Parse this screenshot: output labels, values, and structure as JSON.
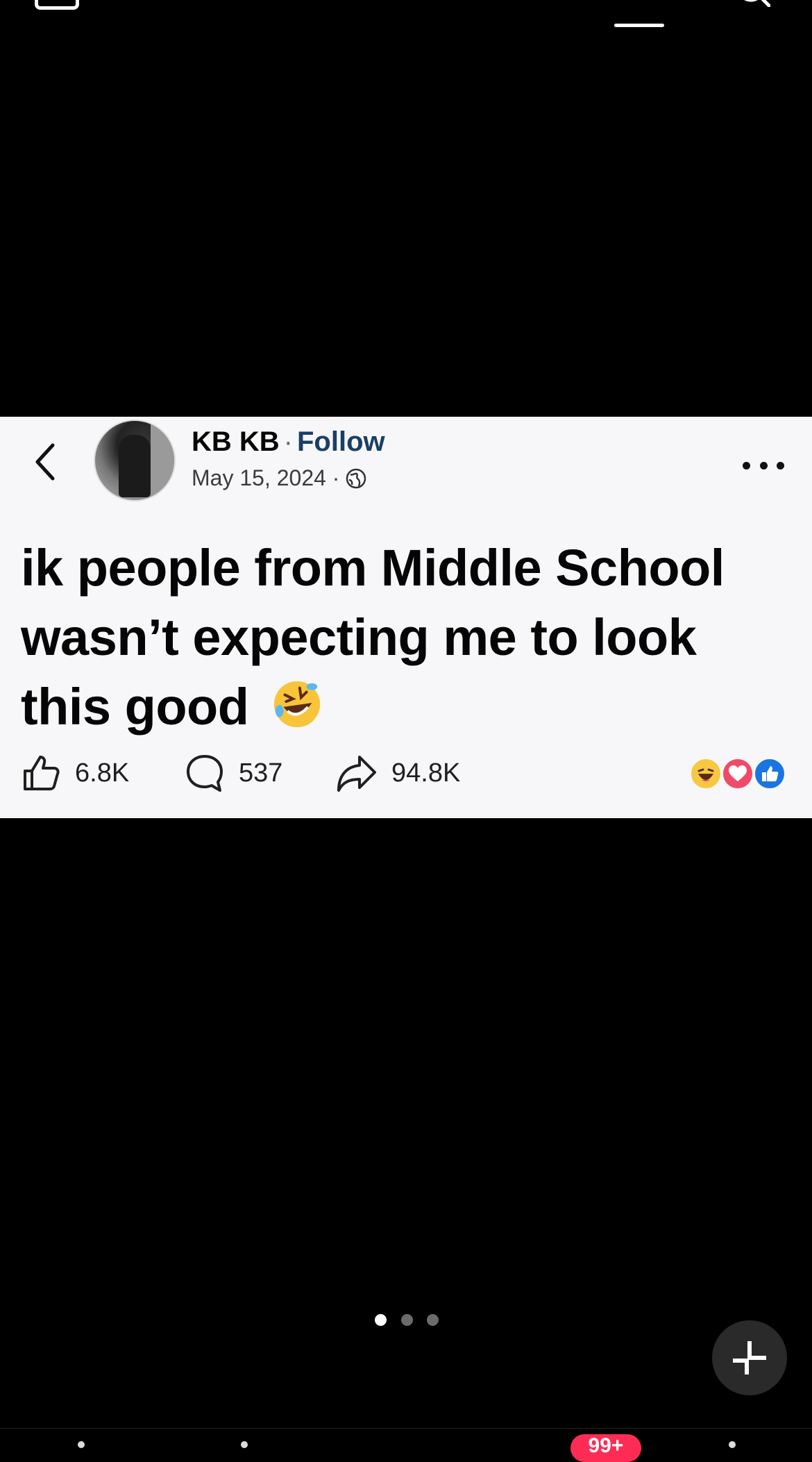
{
  "post": {
    "author": "KB KB",
    "separator": "·",
    "follow_label": "Follow",
    "date": "May 15, 2024 ·",
    "text": "ik people from Middle School wasn’t expecting me to look this good",
    "emoji": "rolling-on-floor-laughing-emoji",
    "stats": {
      "likes": "6.8K",
      "comments": "537",
      "shares": "94.8K"
    },
    "reactions": [
      "haha-reaction-icon",
      "love-reaction-icon",
      "like-reaction-icon"
    ]
  },
  "carousel": {
    "page_count": 3,
    "active_index": 0
  },
  "bottom_nav": {
    "inbox_badge": "99+"
  },
  "colors": {
    "background": "#000000",
    "card_background": "#f7f7f9",
    "follow": "#1b3e66",
    "badge": "#fe2c55",
    "like_reaction": "#1b74e4",
    "love_reaction": "#ef4b68",
    "haha_reaction": "#f7c842"
  }
}
